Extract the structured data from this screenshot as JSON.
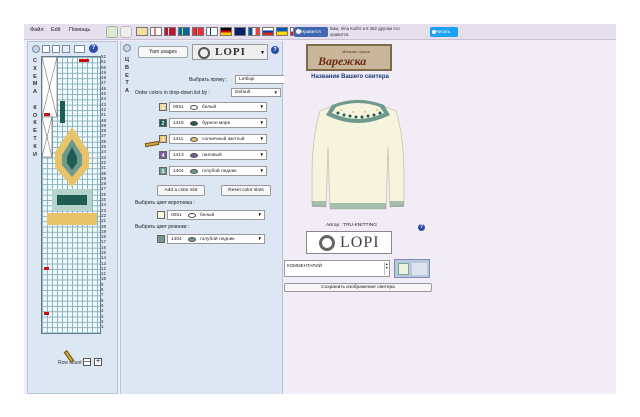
{
  "menu": {
    "file": "Файл",
    "edit": "Edit",
    "help": "Помощь"
  },
  "social": {
    "like_label": "Нравится",
    "like_text": "Вам, Irina Koifer и 8 382 другим это нравится.",
    "tweet_label": "Читать"
  },
  "schema": {
    "vertical_label": [
      "С",
      "Х",
      "Е",
      "М",
      "А",
      "",
      "К",
      "О",
      "К",
      "Е",
      "Т",
      "К",
      "И"
    ],
    "row_numbers": [
      "52",
      "51",
      "50",
      "49",
      "48",
      "47",
      "46",
      "45",
      "44",
      "43",
      "42",
      "41",
      "40",
      "39",
      "38",
      "37",
      "36",
      "35",
      "34",
      "33",
      "32",
      "31",
      "30",
      "29",
      "28",
      "27",
      "26",
      "25",
      "24",
      "23",
      "22",
      "21",
      "20",
      "19",
      "18",
      "17",
      "16",
      "15",
      "14",
      "13",
      "12",
      "11",
      "10",
      "9",
      "8",
      "7",
      "6",
      "5",
      "4",
      "3",
      "2",
      "1"
    ],
    "row_count_label": "Row count",
    "minus": "—",
    "plus": "+"
  },
  "colors_panel": {
    "vertical_label": [
      "Ц",
      "В",
      "Е",
      "Т",
      "А"
    ],
    "yarn_usages": "Yarn usages",
    "brand": "LOPI",
    "yarn_label": "Выбрать пряжу :",
    "yarn_value": "Lettlopi",
    "order_label": "Order colors in drop-down list by :",
    "order_value": "Default",
    "colors": [
      {
        "num": "1",
        "code": "0051",
        "name": "белый",
        "ball": "#ffffff",
        "tag": "#e8d89a"
      },
      {
        "num": "2",
        "code": "1415",
        "name": "бурное море",
        "ball": "#1f5c52",
        "tag": "#1f5c52"
      },
      {
        "num": "3",
        "code": "1411",
        "name": "солнечный желтый",
        "ball": "#e8c36a",
        "tag": "#e8c36a"
      },
      {
        "num": "4",
        "code": "1413",
        "name": "лиловый",
        "ball": "#7a5a95",
        "tag": "#7a5a95"
      },
      {
        "num": "5",
        "code": "1404",
        "name": "голубой ледник",
        "ball": "#6e9a8e",
        "tag": "#6e9a8e"
      }
    ],
    "add_slot": "Add a color slot",
    "reset_slots": "Reset color slots",
    "collar_label": "Выбрать цвет воротника :",
    "collar": {
      "code": "0051",
      "name": "белый",
      "ball": "#ffffff"
    },
    "ribbing_label": "Выбрать цвет резинки :",
    "ribbing": {
      "code": "1404",
      "name": "голубой ледник",
      "ball": "#6e9a8e"
    }
  },
  "preview": {
    "brand_small": "Магазин пряжи",
    "brand_big": "Варежка",
    "title": "Название Вашего свитера",
    "author_label": "Автор :",
    "author_name": "TRU-KNITTING",
    "lopi": "LOPI",
    "comment_placeholder": "КОММЕНТАРИЙ",
    "save": "Сохранить изображение свитера"
  }
}
